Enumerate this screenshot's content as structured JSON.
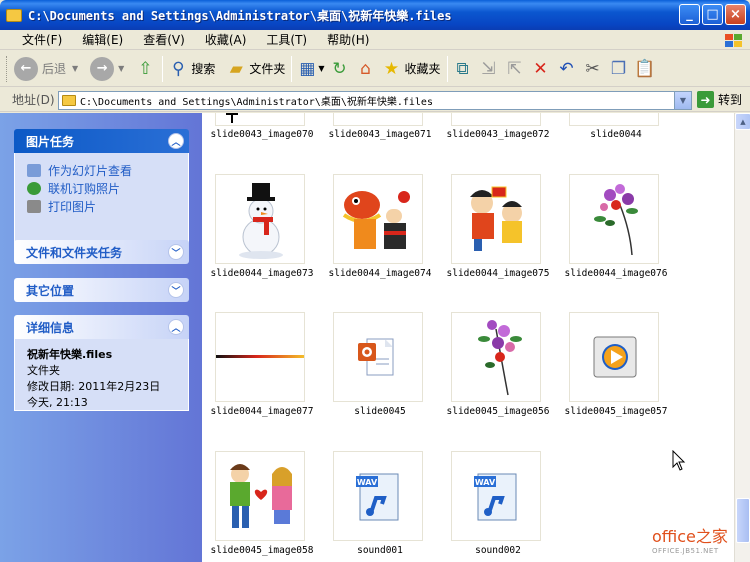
{
  "window": {
    "title": "C:\\Documents and Settings\\Administrator\\桌面\\祝新年快樂.files"
  },
  "menu": [
    "文件(F)",
    "编辑(E)",
    "查看(V)",
    "收藏(A)",
    "工具(T)",
    "帮助(H)"
  ],
  "toolbar": {
    "back": "后退",
    "search": "搜索",
    "folders": "文件夹",
    "favorites": "收藏夹"
  },
  "address": {
    "label": "地址(D)",
    "path": "C:\\Documents and Settings\\Administrator\\桌面\\祝新年快樂.files",
    "go": "转到"
  },
  "tasks": {
    "picture_title": "图片任务",
    "picture_items": [
      "作为幻灯片查看",
      "联机订购照片",
      "打印图片"
    ],
    "file_title": "文件和文件夹任务",
    "other_title": "其它位置",
    "details_title": "详细信息",
    "details": {
      "name": "祝新年快樂.files",
      "type": "文件夹",
      "modified": "修改日期: 2011年2月23日",
      "time": "今天, 21:13"
    }
  },
  "files": [
    "slide0043_image070",
    "slide0043_image071",
    "slide0043_image072",
    "slide0044",
    "slide0044_image073",
    "slide0044_image074",
    "slide0044_image075",
    "slide0044_image076",
    "slide0044_image077",
    "slide0045",
    "slide0045_image056",
    "slide0045_image057",
    "slide0045_image058",
    "sound001",
    "sound002"
  ],
  "watermark": {
    "main": "office之家",
    "sub": "OFFICE.JB51.NET"
  },
  "colors": {
    "titlebar": "#0b57d0",
    "taskpane": "#6f8ee0",
    "link": "#215dc6"
  }
}
